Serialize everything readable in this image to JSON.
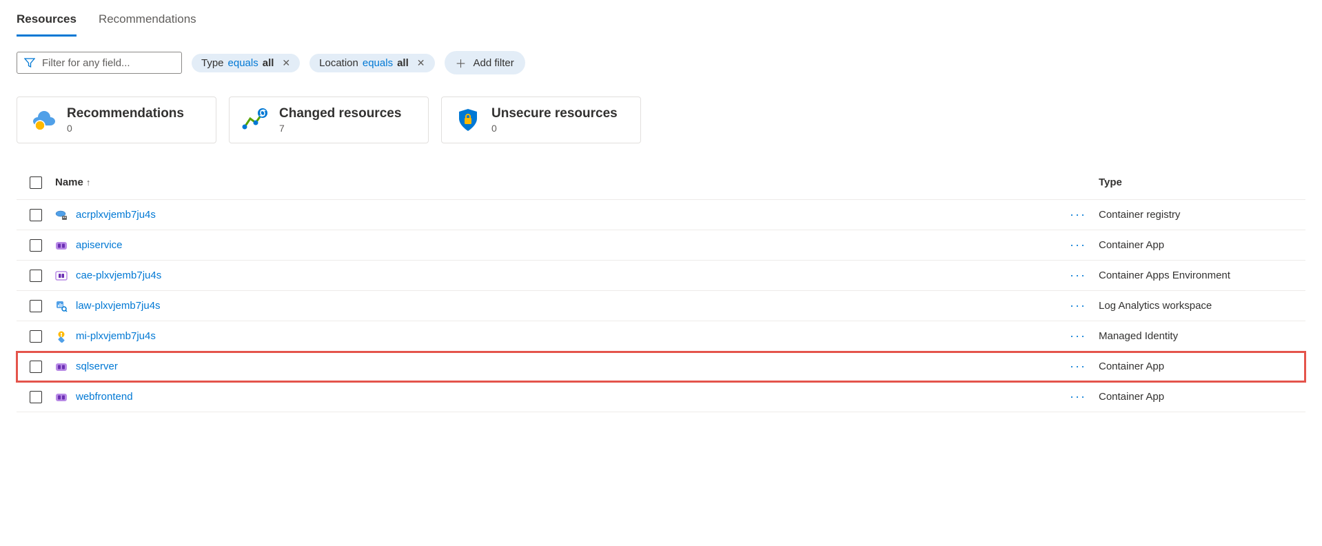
{
  "tabs": {
    "resources": "Resources",
    "recommendations": "Recommendations"
  },
  "filter": {
    "placeholder": "Filter for any field...",
    "pills": [
      {
        "field": "Type",
        "op": "equals",
        "val": "all"
      },
      {
        "field": "Location",
        "op": "equals",
        "val": "all"
      }
    ],
    "add_label": "Add filter"
  },
  "cards": {
    "recommendations": {
      "title": "Recommendations",
      "count": "0"
    },
    "changed": {
      "title": "Changed resources",
      "count": "7"
    },
    "unsecure": {
      "title": "Unsecure resources",
      "count": "0"
    }
  },
  "table": {
    "headers": {
      "name": "Name",
      "type": "Type"
    },
    "rows": [
      {
        "icon": "container-registry",
        "name": "acrplxvjemb7ju4s",
        "type": "Container registry",
        "highlighted": false
      },
      {
        "icon": "container-app",
        "name": "apiservice",
        "type": "Container App",
        "highlighted": false
      },
      {
        "icon": "container-apps-env",
        "name": "cae-plxvjemb7ju4s",
        "type": "Container Apps Environment",
        "highlighted": false
      },
      {
        "icon": "log-analytics",
        "name": "law-plxvjemb7ju4s",
        "type": "Log Analytics workspace",
        "highlighted": false
      },
      {
        "icon": "managed-identity",
        "name": "mi-plxvjemb7ju4s",
        "type": "Managed Identity",
        "highlighted": false
      },
      {
        "icon": "container-app",
        "name": "sqlserver",
        "type": "Container App",
        "highlighted": true
      },
      {
        "icon": "container-app",
        "name": "webfrontend",
        "type": "Container App",
        "highlighted": false
      }
    ]
  }
}
